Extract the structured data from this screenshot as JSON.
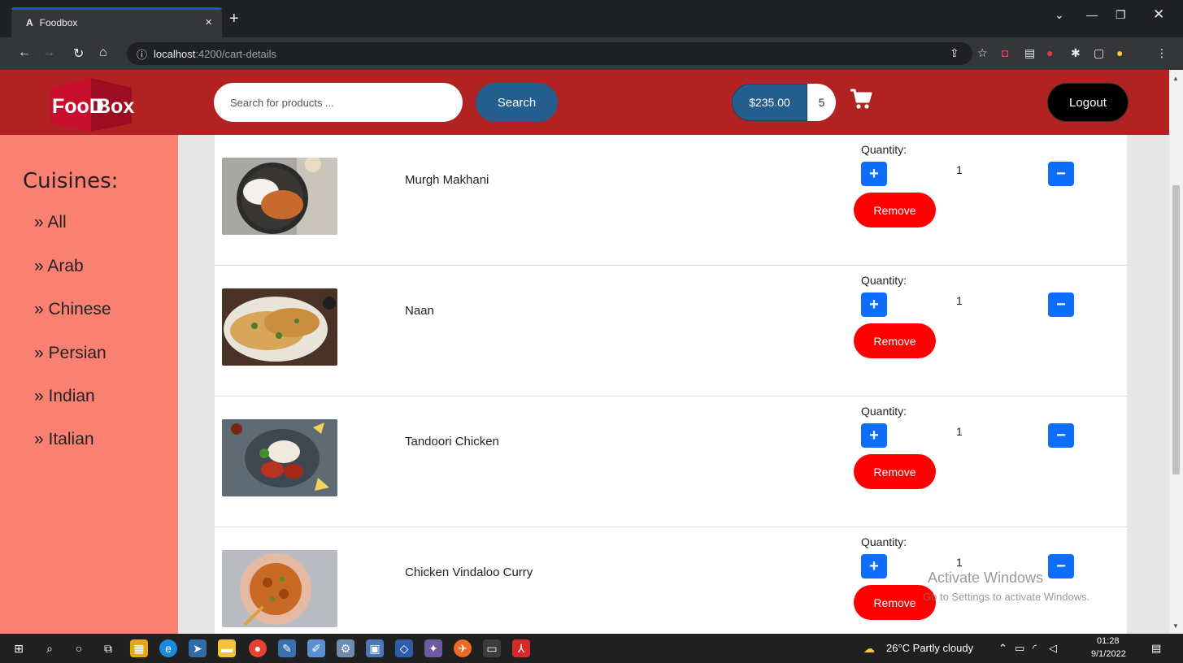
{
  "browser": {
    "tab_favicon": "A",
    "tab_title": "Foodbox",
    "tab_close": "×",
    "new_tab": "+",
    "url_host": "localhost",
    "url_rest": ":4200/cart-details",
    "info_icon": "ⓘ"
  },
  "header": {
    "logo_word1": "FooD",
    "logo_word2": "Box",
    "search_placeholder": "Search for products ...",
    "search_label": "Search",
    "cart_total": "$235.00",
    "cart_count": "5",
    "logout_label": "Logout"
  },
  "sidebar": {
    "title": "Cuisines:",
    "items": [
      {
        "label": "» All"
      },
      {
        "label": "» Arab"
      },
      {
        "label": "» Chinese"
      },
      {
        "label": "» Persian"
      },
      {
        "label": "» Indian"
      },
      {
        "label": "» Italian"
      }
    ]
  },
  "cart": {
    "quantity_label": "Quantity:",
    "remove_label": "Remove",
    "plus_symbol": "+",
    "minus_symbol": "−",
    "items": [
      {
        "name": "Murgh Makhani",
        "quantity": "1"
      },
      {
        "name": "Naan",
        "quantity": "1"
      },
      {
        "name": "Tandoori Chicken",
        "quantity": "1"
      },
      {
        "name": "Chicken Vindaloo Curry",
        "quantity": "1"
      }
    ]
  },
  "watermark": {
    "line1": "Activate Windows",
    "line2": "Go to Settings to activate Windows."
  },
  "taskbar": {
    "weather": "26°C  Partly cloudy",
    "time": "01:28",
    "date": "9/1/2022"
  },
  "colors": {
    "header": "#b22222",
    "sidebar": "#fa8072",
    "search_button": "#235e8c",
    "primary": "#0d6efd",
    "remove": "#ff0000"
  }
}
